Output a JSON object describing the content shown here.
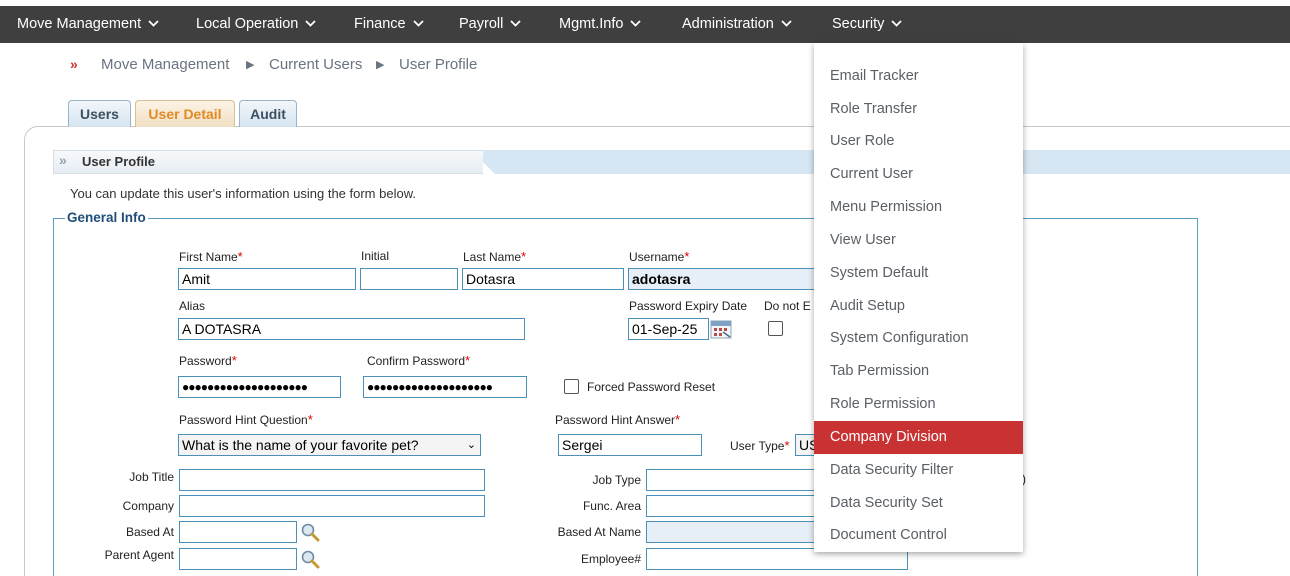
{
  "nav": {
    "items": [
      {
        "label": "Move Management"
      },
      {
        "label": "Local Operation"
      },
      {
        "label": "Finance"
      },
      {
        "label": "Payroll"
      },
      {
        "label": "Mgmt.Info"
      },
      {
        "label": "Administration"
      },
      {
        "label": "Security"
      }
    ],
    "chevron": "⌄"
  },
  "breadcrumb": {
    "marker": "»",
    "items": [
      "Move Management",
      "Current Users",
      "User Profile"
    ],
    "separator": "▶"
  },
  "tabs": [
    {
      "label": "Users",
      "active": false
    },
    {
      "label": "User Detail",
      "active": true
    },
    {
      "label": "Audit",
      "active": false
    }
  ],
  "section": {
    "title": "User Profile",
    "icon": "double-chevron-icon",
    "description": "You can update this user's information using the form below.",
    "legend": "General Info"
  },
  "form": {
    "first_name_label": "First Name",
    "first_name": "Amit",
    "initial_label": "Initial",
    "initial": "",
    "last_name_label": "Last Name",
    "last_name": "Dotasra",
    "username_label": "Username",
    "username": "adotasra",
    "alias_label": "Alias",
    "alias": "A DOTASRA",
    "pwd_expiry_label": "Password Expiry Date",
    "pwd_expiry": "01-Sep-25",
    "do_not_label": "Do not E",
    "password_label": "Password",
    "password": "●●●●●●●●●●●●●●●●●●●●",
    "confirm_label": "Confirm Password",
    "confirm": "●●●●●●●●●●●●●●●●●●●●",
    "forced_reset_label": "Forced Password Reset",
    "hint_q_label": "Password Hint Question",
    "hint_q": "What is the name of your favorite pet?",
    "hint_a_label": "Password Hint Answer",
    "hint_a": "Sergei",
    "user_type_label": "User Type",
    "user_type": "US",
    "job_title_label": "Job Title",
    "job_type_label": "Job Type",
    "company_label": "Company",
    "func_area_label": "Func. Area",
    "based_at_label": "Based At",
    "based_at_name_label": "Based At Name",
    "parent_agent_label": "Parent Agent",
    "employee_label": "Employee#",
    "required_mark": "*",
    "stray_paren": ")"
  },
  "menu": {
    "items": [
      "Email Tracker",
      "Role Transfer",
      "User Role",
      "Current User",
      "Menu Permission",
      "View User",
      "System Default",
      "Audit Setup",
      "System Configuration",
      "Tab Permission",
      "Role Permission",
      "Company Division",
      "Data Security Filter",
      "Data Security Set",
      "Document Control"
    ],
    "highlighted": "Company Division"
  },
  "colors": {
    "nav_bg": "#3f3f3f",
    "menu_highlight": "#c83232",
    "active_tab_text": "#e08a24"
  }
}
